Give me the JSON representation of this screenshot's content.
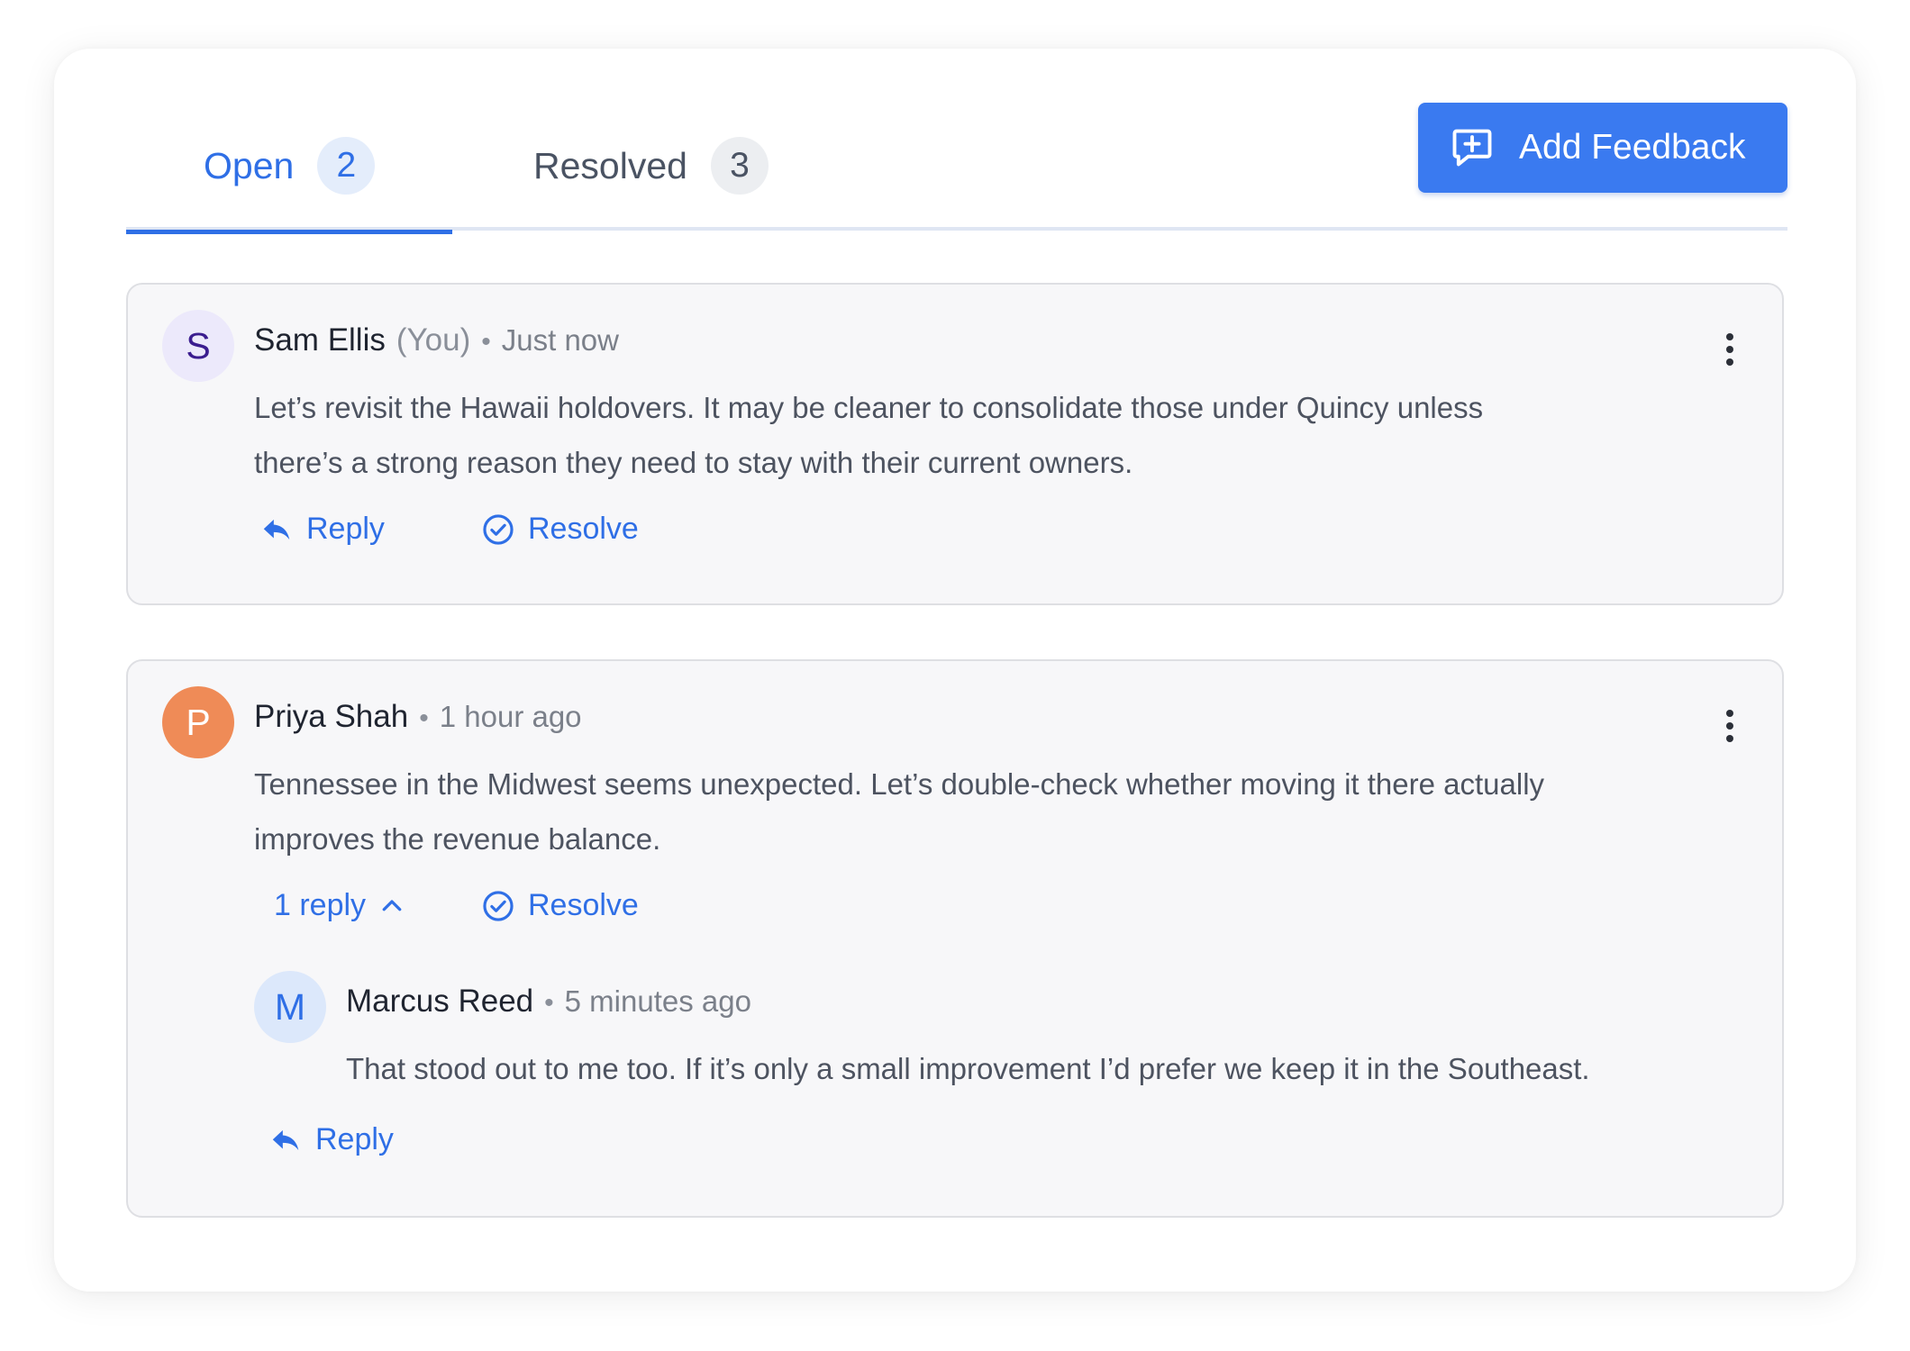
{
  "tabs": {
    "open": {
      "label": "Open",
      "count": "2"
    },
    "resolved": {
      "label": "Resolved",
      "count": "3"
    }
  },
  "add_feedback": {
    "label": "Add Feedback",
    "icon": "message-plus-icon"
  },
  "comments": [
    {
      "avatar_letter": "S",
      "avatar_bg": "#ece9fb",
      "avatar_fg": "#3b1d8f",
      "author": "Sam Ellis",
      "you_tag": "(You)",
      "separator": "•",
      "time": "Just now",
      "body_line1": "Let’s revisit the Hawaii holdovers. It may be cleaner to consolidate those under Quincy unless",
      "body_line2": "there’s a strong reason they need to stay with their current owners.",
      "reply_label": "Reply",
      "resolve_label": "Resolve"
    },
    {
      "avatar_letter": "P",
      "avatar_bg": "#ef8b57",
      "avatar_fg": "#ffffff",
      "author": "Priya Shah",
      "separator": "•",
      "time": "1 hour ago",
      "body_line1": "Tennessee in the Midwest seems unexpected. Let’s double-check whether moving it there actually",
      "body_line2": "improves the revenue balance.",
      "replies_toggle_label": "1 reply",
      "resolve_label": "Resolve",
      "replies": [
        {
          "avatar_letter": "M",
          "avatar_bg": "#dce8fb",
          "avatar_fg": "#2f6fe6",
          "author": "Marcus Reed",
          "separator": "•",
          "time": "5 minutes ago",
          "body": "That stood out to me too. If it’s only a small improvement I’d prefer we keep it in the Southeast."
        }
      ],
      "reply_label": "Reply"
    }
  ],
  "colors": {
    "accent": "#2f6fe6",
    "button": "#3a7af0",
    "card_bg": "#f7f7f9"
  }
}
